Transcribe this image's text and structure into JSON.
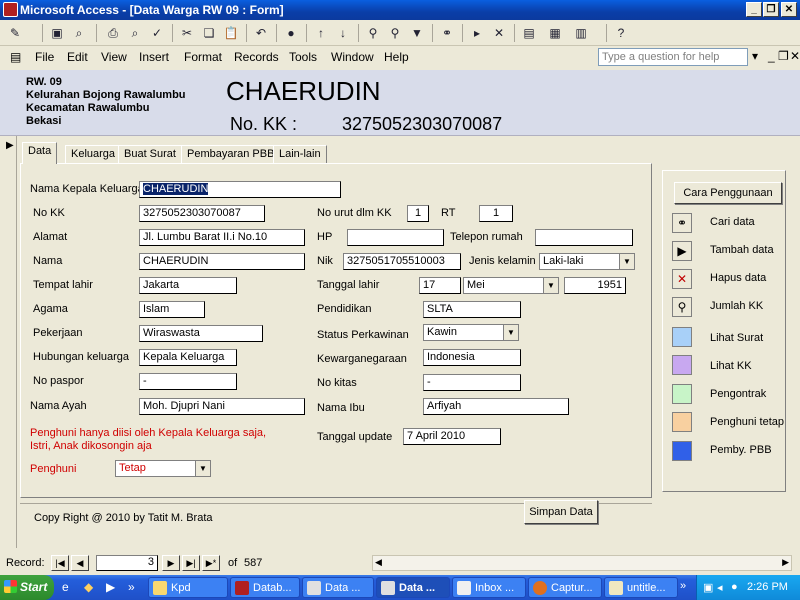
{
  "window": {
    "title": "Microsoft Access - [Data Warga RW 09 : Form]"
  },
  "menu": [
    "File",
    "Edit",
    "View",
    "Insert",
    "Format",
    "Records",
    "Tools",
    "Window",
    "Help"
  ],
  "help_placeholder": "Type a question for help",
  "header": {
    "line1": "RW. 09",
    "line2": "Kelurahan Bojong Rawalumbu",
    "line3": "Kecamatan Rawalumbu",
    "line4": "Bekasi",
    "name": "CHAERUDIN",
    "kk_label": "No. KK  :",
    "kk_value": "3275052303070087"
  },
  "tabs": [
    "Data",
    "Keluarga",
    "Buat Surat",
    "Pembayaran PBB",
    "Lain-lain"
  ],
  "form": {
    "nama_kepala_label": "Nama Kepala Keluarga",
    "nama_kepala_value": "CHAERUDIN",
    "nokk_label": "No KK",
    "nokk_value": "3275052303070087",
    "nourut_label": "No urut dlm KK",
    "nourut_value": "1",
    "rt_label": "RT",
    "rt_value": "1",
    "alamat_label": "Alamat",
    "alamat_value": "Jl. Lumbu Barat II.i No.10",
    "hp_label": "HP",
    "hp_value": "",
    "telp_label": "Telepon rumah",
    "telp_value": "",
    "nama_label": "Nama",
    "nama_value": "CHAERUDIN",
    "nik_label": "Nik",
    "nik_value": "3275051705510003",
    "jk_label": "Jenis kelamin",
    "jk_value": "Laki-laki",
    "tempat_label": "Tempat lahir",
    "tempat_value": "Jakarta",
    "tgl_label": "Tanggal lahir",
    "tgl_day": "17",
    "tgl_month": "Mei",
    "tgl_year": "1951",
    "agama_label": "Agama",
    "agama_value": "Islam",
    "pendidikan_label": "Pendidikan",
    "pendidikan_value": "SLTA",
    "pekerjaan_label": "Pekerjaan",
    "pekerjaan_value": "Wiraswasta",
    "status_label": "Status Perkawinan",
    "status_value": "Kawin",
    "hubungan_label": "Hubungan keluarga",
    "hubungan_value": "Kepala Keluarga",
    "warga_label": "Kewarganegaraan",
    "warga_value": "Indonesia",
    "paspor_label": "No paspor",
    "paspor_value": "-",
    "kitas_label": "No kitas",
    "kitas_value": "-",
    "ayah_label": "Nama Ayah",
    "ayah_value": "Moh. Djupri Nani",
    "ibu_label": "Nama Ibu",
    "ibu_value": "Arfiyah",
    "note_line1": "Penghuni hanya diisi oleh Kepala Keluarga saja,",
    "note_line2": "Istri, Anak dikosongin aja",
    "update_label": "Tanggal update",
    "update_value": "7 April 2010",
    "penghuni_label": "Penghuni",
    "penghuni_value": "Tetap",
    "copyright": "Copy Right @ 2010 by Tatit M. Brata",
    "simpan_label": "Simpan Data"
  },
  "side": {
    "cara_label": "Cara Penggunaan",
    "items": [
      "Cari data",
      "Tambah data",
      "Hapus  data",
      "Jumlah KK",
      "Lihat Surat",
      "Lihat KK",
      "Pengontrak",
      "Penghuni tetap",
      "Pemby. PBB"
    ]
  },
  "record": {
    "label": "Record:",
    "current": "3",
    "of_label": "of",
    "total": "587"
  },
  "taskbar": {
    "start": "Start",
    "tasks": [
      "Kpd",
      "Datab...",
      "Data ...",
      "Data ...",
      "Inbox ...",
      "Captur...",
      "untitle..."
    ],
    "clock": "2:26 PM"
  }
}
